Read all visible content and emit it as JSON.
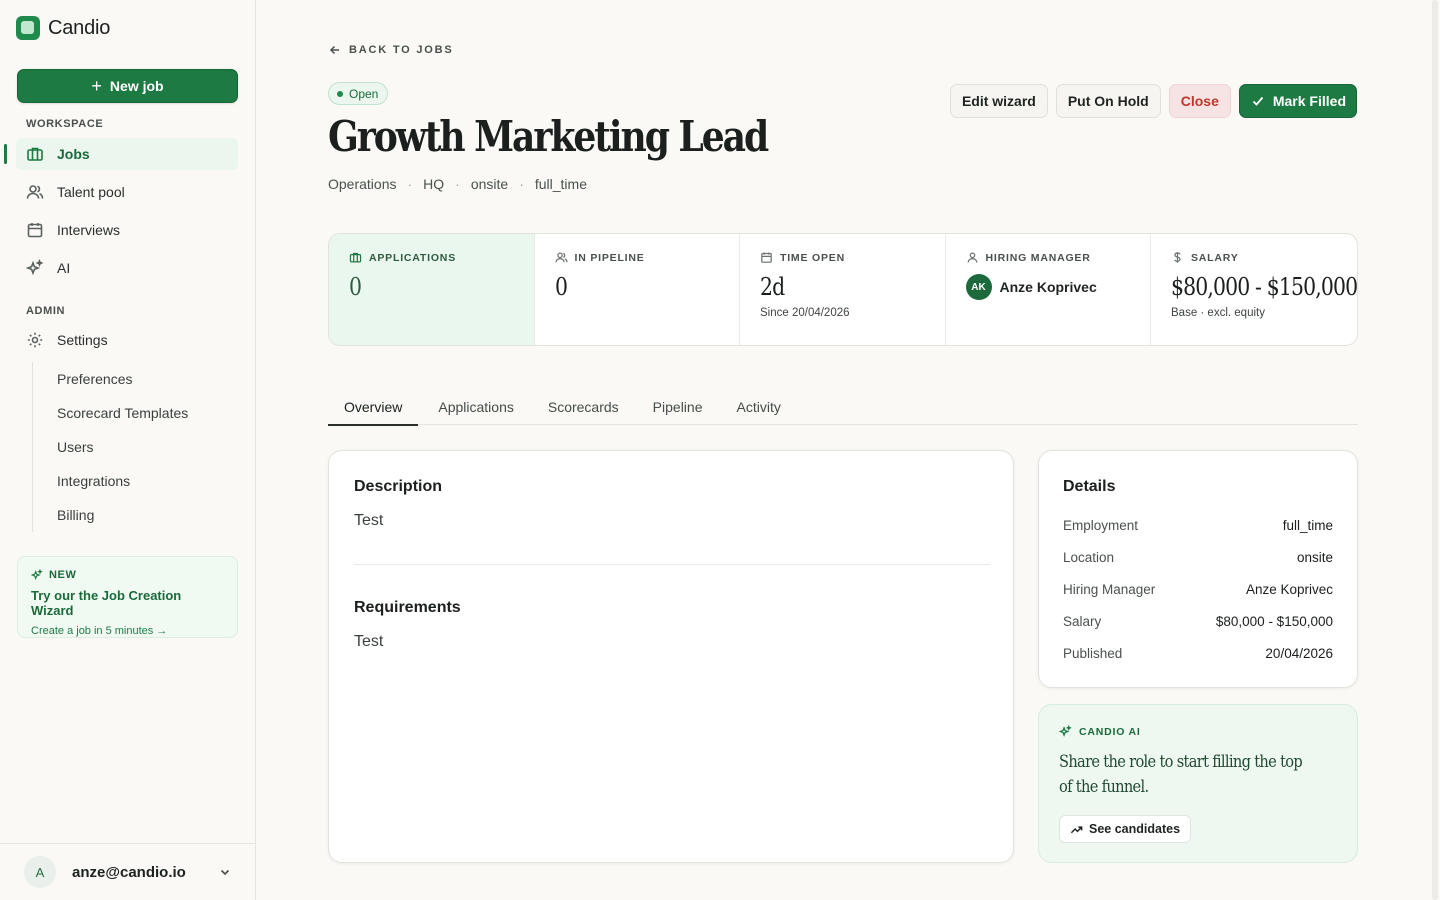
{
  "app": {
    "name": "Candio"
  },
  "sidebar": {
    "new_job_label": "New job",
    "workspace_label": "WORKSPACE",
    "admin_label": "ADMIN",
    "items": [
      {
        "label": "Jobs",
        "icon": "briefcase-icon",
        "active": true
      },
      {
        "label": "Talent pool",
        "icon": "users-icon"
      },
      {
        "label": "Interviews",
        "icon": "calendar-icon"
      },
      {
        "label": "AI",
        "icon": "sparkles-icon"
      }
    ],
    "settings": {
      "label": "Settings",
      "icon": "gear-icon"
    },
    "subitems": [
      "Preferences",
      "Scorecard Templates",
      "Users",
      "Integrations",
      "Billing"
    ],
    "promo": {
      "tag": "NEW",
      "title": "Try our the Job Creation Wizard",
      "link": "Create a job in 5 minutes →"
    },
    "user": {
      "initial": "A",
      "email": "anze@candio.io"
    }
  },
  "job": {
    "back_label": "BACK TO JOBS",
    "status": "Open",
    "title": "Growth Marketing Lead",
    "meta": [
      "Operations",
      "HQ",
      "onsite",
      "full_time"
    ],
    "meta_separator": "·",
    "actions": {
      "edit": "Edit wizard",
      "hold": "Put On Hold",
      "close": "Close",
      "filled": "Mark Filled"
    }
  },
  "stats": {
    "applications": {
      "label": "APPLICATIONS",
      "value": "0"
    },
    "pipeline": {
      "label": "IN PIPELINE",
      "value": "0"
    },
    "time_open": {
      "label": "TIME OPEN",
      "value": "2d",
      "sub": "Since 20/04/2026"
    },
    "hiring_manager": {
      "label": "HIRING MANAGER",
      "initials": "AK",
      "name": "Anze Koprivec"
    },
    "salary": {
      "label": "SALARY",
      "value": "$80,000 - $150,000",
      "sub": "Base · excl. equity"
    }
  },
  "tabs": [
    "Overview",
    "Applications",
    "Scorecards",
    "Pipeline",
    "Activity"
  ],
  "overview": {
    "description_title": "Description",
    "description": "Test",
    "requirements_title": "Requirements",
    "requirements": "Test"
  },
  "details": {
    "title": "Details",
    "rows": [
      {
        "key": "Employment",
        "value": "full_time"
      },
      {
        "key": "Location",
        "value": "onsite"
      },
      {
        "key": "Hiring Manager",
        "value": "Anze Koprivec"
      },
      {
        "key": "Salary",
        "value": "$80,000 - $150,000"
      },
      {
        "key": "Published",
        "value": "20/04/2026"
      }
    ]
  },
  "ai": {
    "label": "CANDIO AI",
    "text": "Share the role to start filling the top of the funnel.",
    "button": "See candidates"
  },
  "colors": {
    "brand": "#1c7a42",
    "close": "#c0372b",
    "background": "#faf9f6"
  }
}
